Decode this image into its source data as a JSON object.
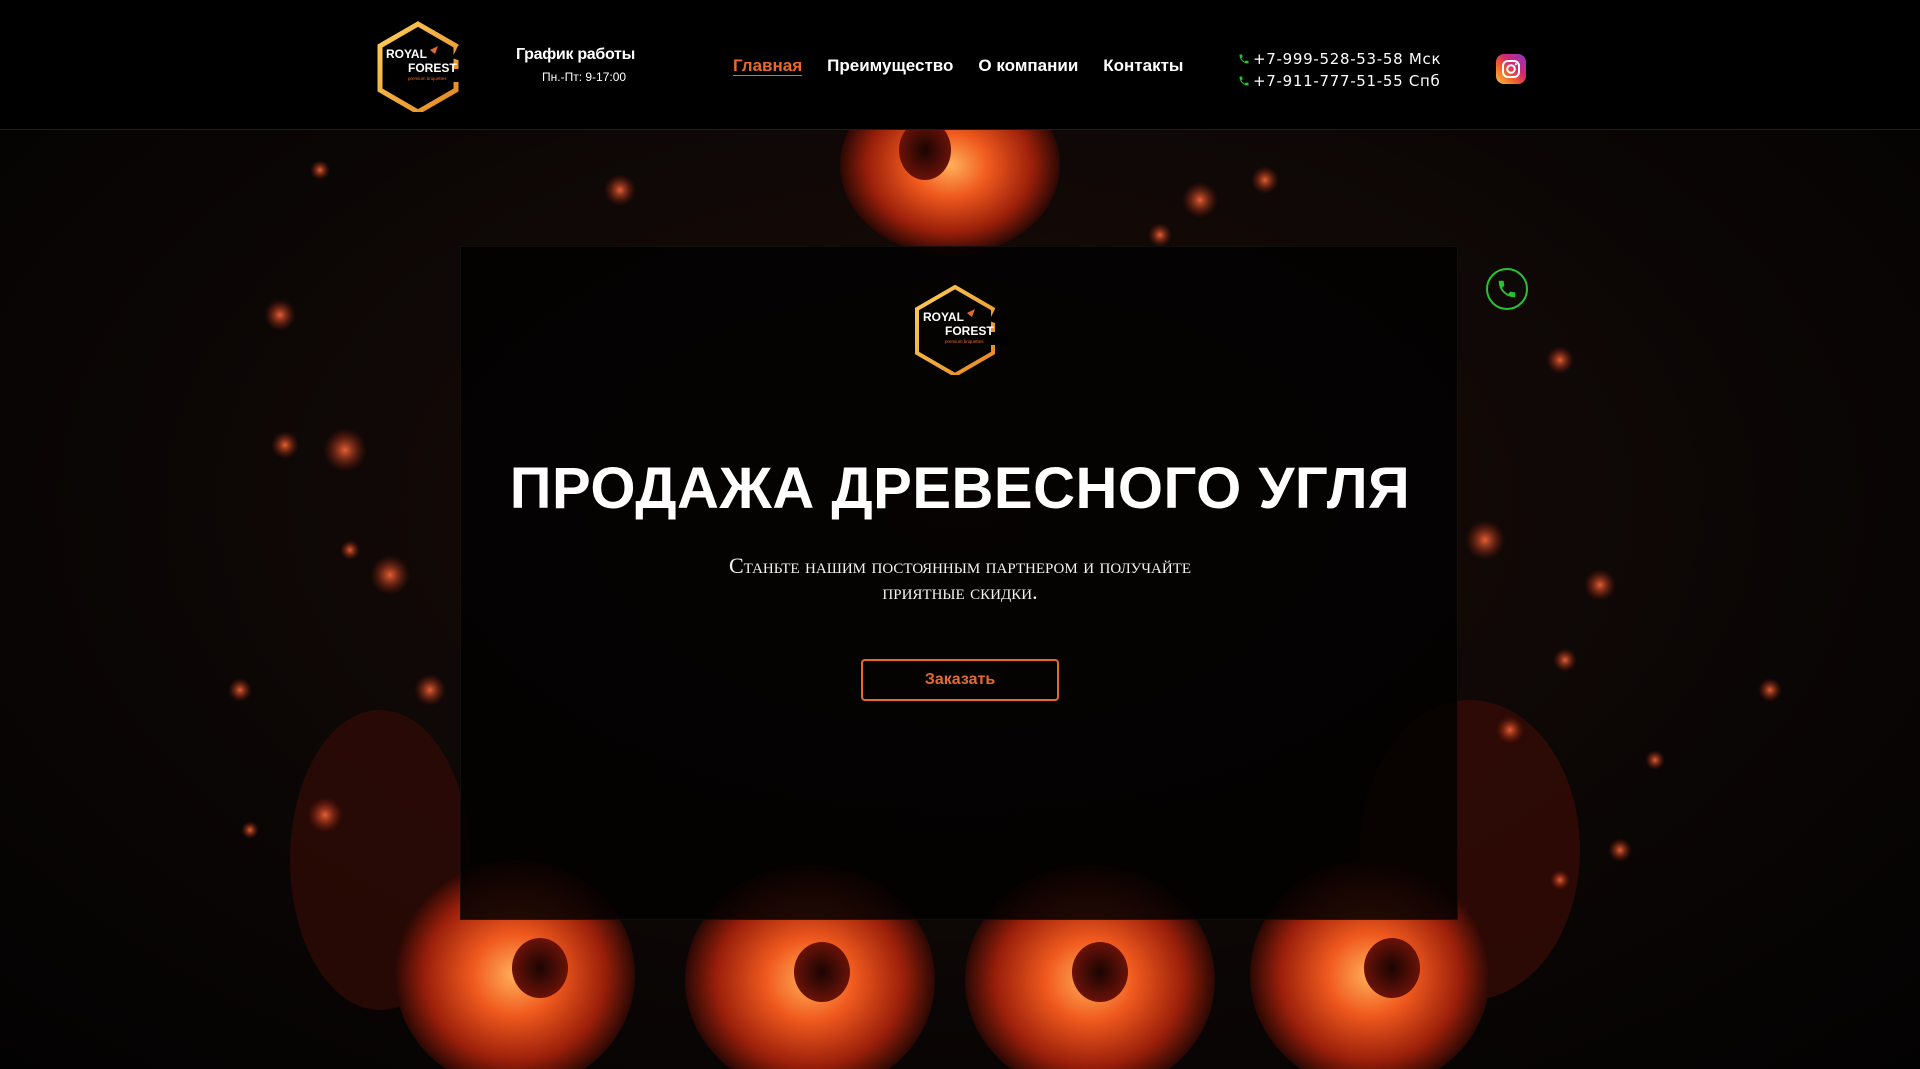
{
  "brand": {
    "logo_line1": "ROYAL",
    "logo_line2": "FOREST",
    "logo_tagline": "premium briquettes",
    "accent_color": "#e8692c",
    "logo_gold": "#f2a93b"
  },
  "header": {
    "schedule_title": "График работы",
    "schedule_hours": "Пн.-Пт: 9-17:00",
    "nav": [
      {
        "label": "Главная",
        "active": true
      },
      {
        "label": "Преимущество",
        "active": false
      },
      {
        "label": "О компании",
        "active": false
      },
      {
        "label": "Контакты",
        "active": false
      }
    ],
    "phones": [
      {
        "number": "+7-999-528-53-58 Мск"
      },
      {
        "number": "+7-911-777-51-55 Спб"
      }
    ],
    "phone_icon": "phone-icon",
    "phone_icon_color": "#29c134",
    "social_icon": "instagram-icon"
  },
  "call_button": {
    "icon": "phone-icon",
    "color": "#29c134"
  },
  "hero": {
    "title": "ПРОДАЖА ДРЕВЕСНОГО УГЛЯ",
    "subtitle": "Станьте нашим постоянным партнером и получайте приятные скидки.",
    "cta_label": "Заказать"
  }
}
